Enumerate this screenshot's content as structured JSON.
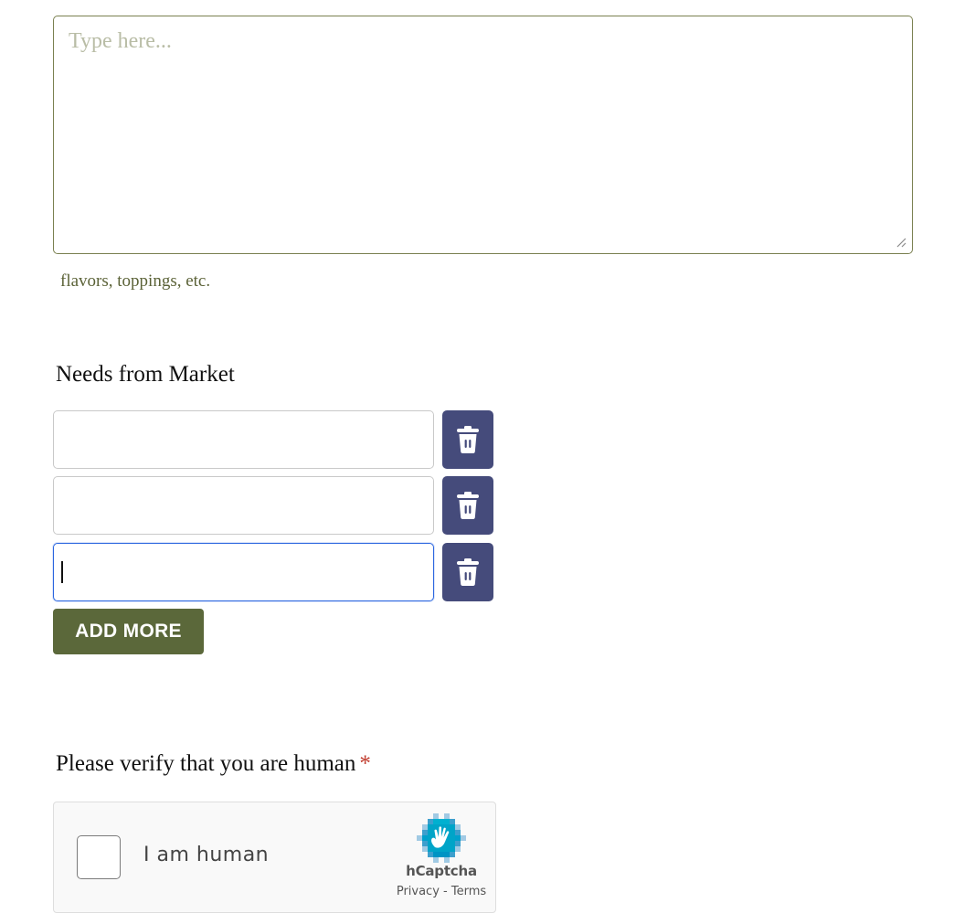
{
  "notes_field": {
    "placeholder": "Type here...",
    "value": "",
    "hint": "flavors, toppings, etc."
  },
  "market_needs": {
    "label": "Needs from Market",
    "items": [
      {
        "value": ""
      },
      {
        "value": ""
      },
      {
        "value": ""
      }
    ],
    "delete_icon": "trash-icon",
    "add_more_label": "ADD MORE"
  },
  "verification": {
    "label": "Please verify that you are human",
    "required_marker": "*",
    "captcha": {
      "checkbox_label": "I am human",
      "checked": false,
      "brand": "hCaptcha",
      "privacy_link": "Privacy",
      "separator": " - ",
      "terms_link": "Terms",
      "logo_icon": "hcaptcha-hand-icon"
    }
  },
  "colors": {
    "accent_green": "#5b683a",
    "delete_button": "#454b7b",
    "focus_blue": "#2b66e0",
    "required_red": "#c0392b"
  }
}
